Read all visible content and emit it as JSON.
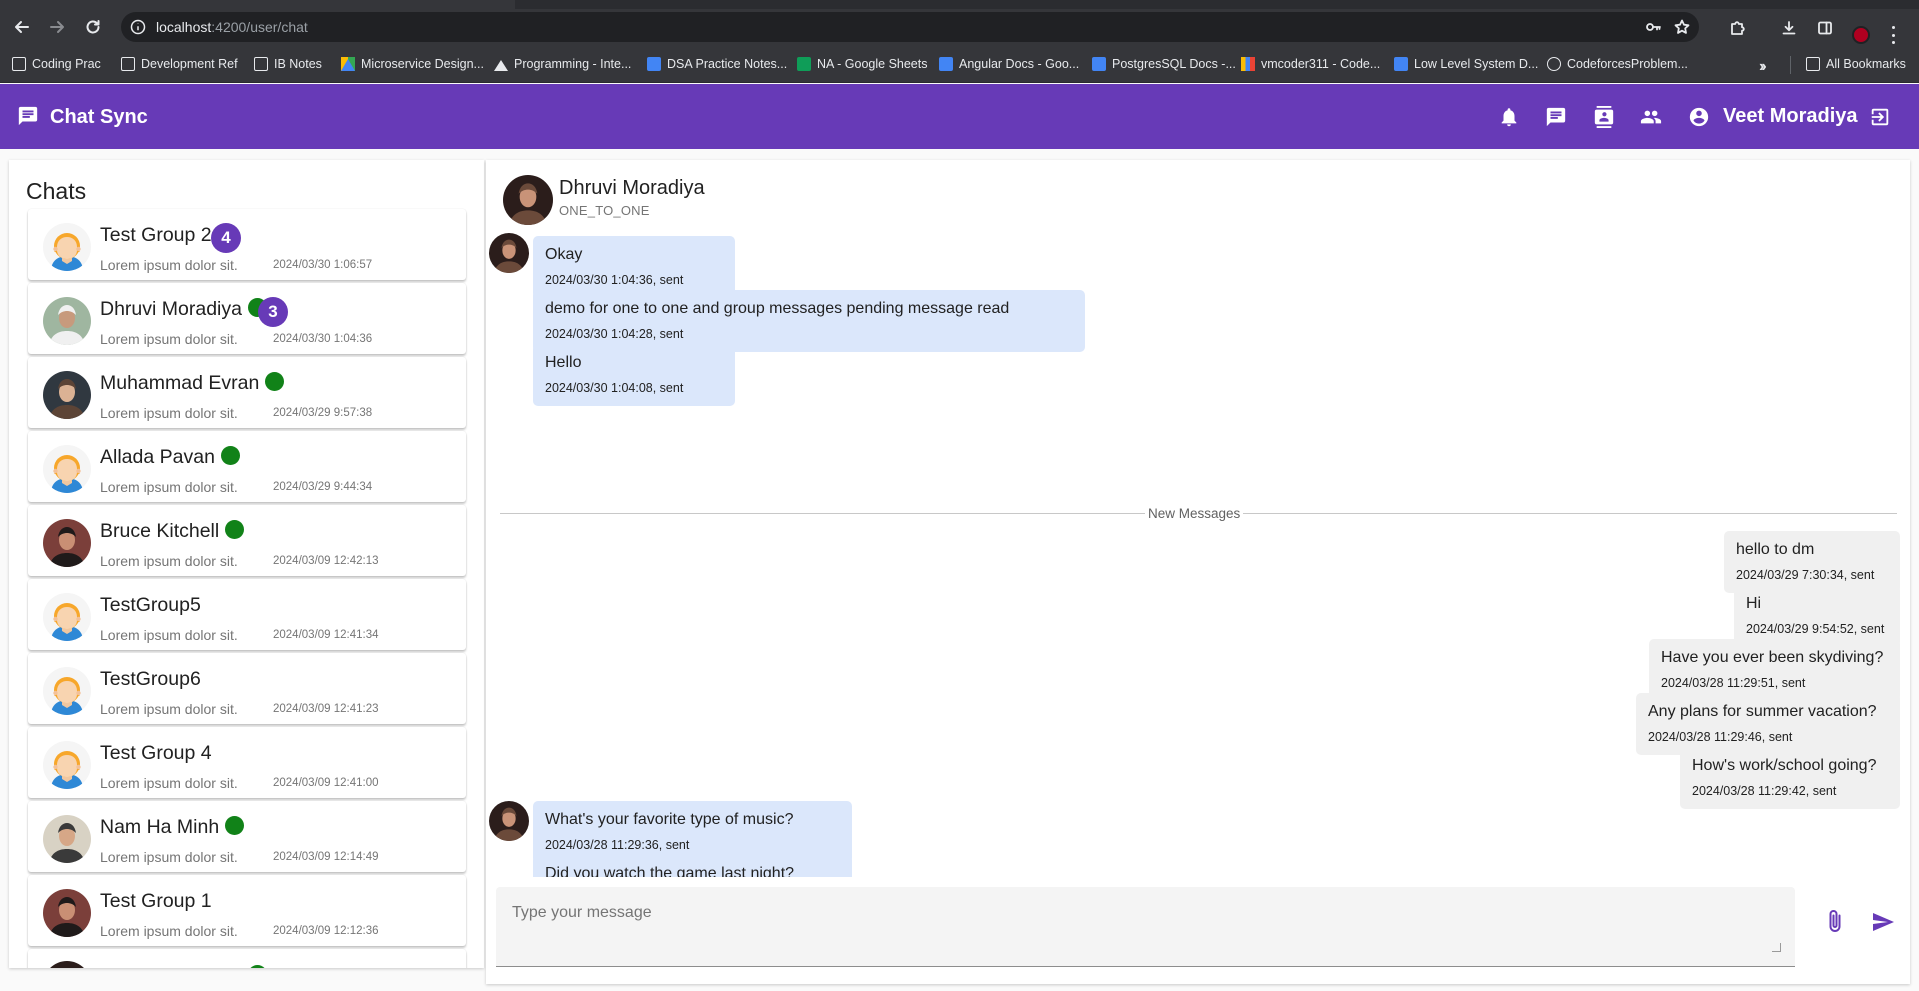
{
  "browser": {
    "url_host": "localhost",
    "url_path": ":4200/user/chat",
    "bookmarks": [
      {
        "label": "Coding Prac",
        "icon": "folder-icon"
      },
      {
        "label": "Development Ref",
        "icon": "folder-icon"
      },
      {
        "label": "IB Notes",
        "icon": "folder-icon"
      },
      {
        "label": "Microservice Design...",
        "icon": "google-drive-icon"
      },
      {
        "label": "Programming - Inte...",
        "icon": "mountain-icon"
      },
      {
        "label": "DSA Practice Notes...",
        "icon": "google-docs-icon"
      },
      {
        "label": "NA - Google Sheets",
        "icon": "google-sheets-icon"
      },
      {
        "label": "Angular Docs - Goo...",
        "icon": "google-docs-icon"
      },
      {
        "label": "PostgresSQL Docs -...",
        "icon": "google-docs-icon"
      },
      {
        "label": "vmcoder311 - Code...",
        "icon": "bar-chart-icon"
      },
      {
        "label": "Low Level System D...",
        "icon": "google-docs-icon"
      },
      {
        "label": "CodeforcesProblem...",
        "icon": "globe-icon"
      }
    ],
    "all_bookmarks": "All Bookmarks"
  },
  "header": {
    "title": "Chat Sync",
    "user_name": "Veet Moradiya",
    "brand_color": "#673ab7"
  },
  "chats": {
    "title": "Chats",
    "items": [
      {
        "name": "Test Group 2",
        "preview": "Lorem ipsum dolor sit.",
        "time": "2024/03/30 1:06:57",
        "online": false,
        "unread": "4",
        "avatar": "group-avatar"
      },
      {
        "name": "Dhruvi Moradiya",
        "preview": "Lorem ipsum dolor sit.",
        "time": "2024/03/30 1:04:36",
        "online": true,
        "unread": "3",
        "avatar": "user-photo-avatar"
      },
      {
        "name": "Muhammad Evran",
        "preview": "Lorem ipsum dolor sit.",
        "time": "2024/03/29 9:57:38",
        "online": true,
        "unread": null,
        "avatar": "user-photo-avatar"
      },
      {
        "name": "Allada Pavan",
        "preview": "Lorem ipsum dolor sit.",
        "time": "2024/03/29 9:44:34",
        "online": true,
        "unread": null,
        "avatar": "group-avatar"
      },
      {
        "name": "Bruce Kitchell",
        "preview": "Lorem ipsum dolor sit.",
        "time": "2024/03/09 12:42:13",
        "online": true,
        "unread": null,
        "avatar": "user-photo-avatar"
      },
      {
        "name": "TestGroup5",
        "preview": "Lorem ipsum dolor sit.",
        "time": "2024/03/09 12:41:34",
        "online": false,
        "unread": null,
        "avatar": "group-avatar"
      },
      {
        "name": "TestGroup6",
        "preview": "Lorem ipsum dolor sit.",
        "time": "2024/03/09 12:41:23",
        "online": false,
        "unread": null,
        "avatar": "group-avatar"
      },
      {
        "name": "Test Group 4",
        "preview": "Lorem ipsum dolor sit.",
        "time": "2024/03/09 12:41:00",
        "online": false,
        "unread": null,
        "avatar": "group-avatar"
      },
      {
        "name": "Nam Ha Minh",
        "preview": "Lorem ipsum dolor sit.",
        "time": "2024/03/09 12:14:49",
        "online": true,
        "unread": null,
        "avatar": "user-photo-avatar"
      },
      {
        "name": "Test Group 1",
        "preview": "Lorem ipsum dolor sit.",
        "time": "2024/03/09 12:12:36",
        "online": false,
        "unread": null,
        "avatar": "user-photo-avatar"
      }
    ]
  },
  "conversation": {
    "name": "Dhruvi Moradiya",
    "type": "ONE_TO_ONE",
    "divider": "New Messages",
    "messages": [
      {
        "dir": "in",
        "text": "Okay",
        "meta": "2024/03/30 1:04:36, sent"
      },
      {
        "dir": "in",
        "text": "demo for one to one and group messages pending message read",
        "meta": "2024/03/30 1:04:28, sent"
      },
      {
        "dir": "in",
        "text": "Hello",
        "meta": "2024/03/30 1:04:08, sent"
      },
      {
        "dir": "out",
        "text": "hello to dm",
        "meta": "2024/03/29 7:30:34, sent"
      },
      {
        "dir": "out",
        "text": "Hi",
        "meta": "2024/03/29 9:54:52, sent"
      },
      {
        "dir": "out",
        "text": "Have you ever been skydiving?",
        "meta": "2024/03/28 11:29:51, sent"
      },
      {
        "dir": "out",
        "text": "Any plans for summer vacation?",
        "meta": "2024/03/28 11:29:46, sent"
      },
      {
        "dir": "out",
        "text": "How's work/school going?",
        "meta": "2024/03/28 11:29:42, sent"
      },
      {
        "dir": "in",
        "text": "What's your favorite type of music?",
        "meta": "2024/03/28 11:29:36, sent"
      },
      {
        "dir": "in",
        "text": "Did you watch the game last night?",
        "meta": ""
      }
    ],
    "composer_placeholder": "Type your message",
    "incoming_bubble_color": "#dbe7fb",
    "outgoing_bubble_color": "#f0f0f0",
    "online_color": "#118218"
  }
}
